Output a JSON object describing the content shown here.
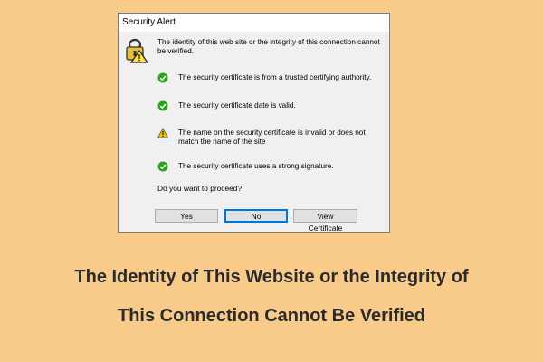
{
  "dialog": {
    "title": "Security Alert",
    "header_icon": "padlock-warning-icon",
    "message": "The identity of this web site or the integrity of this connection cannot be verified.",
    "checks": [
      {
        "status": "ok",
        "icon": "green-check-icon",
        "text": "The security certificate is from a trusted certifying authority."
      },
      {
        "status": "ok",
        "icon": "green-check-icon",
        "text": "The security certificate date is valid."
      },
      {
        "status": "warning",
        "icon": "yellow-warning-icon",
        "text": "The name on the security certificate is invalid or does not match the name of the site"
      },
      {
        "status": "ok",
        "icon": "green-check-icon",
        "text": "The security certificate uses a strong signature."
      }
    ],
    "question": "Do you want to proceed?",
    "buttons": {
      "yes": "Yes",
      "no": "No",
      "view_certificate": "View Certificate"
    }
  },
  "caption": {
    "line1": "The Identity of This Website or the Integrity of",
    "line2": "This Connection Cannot Be Verified"
  },
  "colors": {
    "background": "#f8cb8a",
    "dialog_bg": "#f0f0f0",
    "check_green": "#2aa31f",
    "warning_yellow": "#f2c200",
    "focus_blue": "#0078d7",
    "caption_text": "#2a2a2a"
  }
}
